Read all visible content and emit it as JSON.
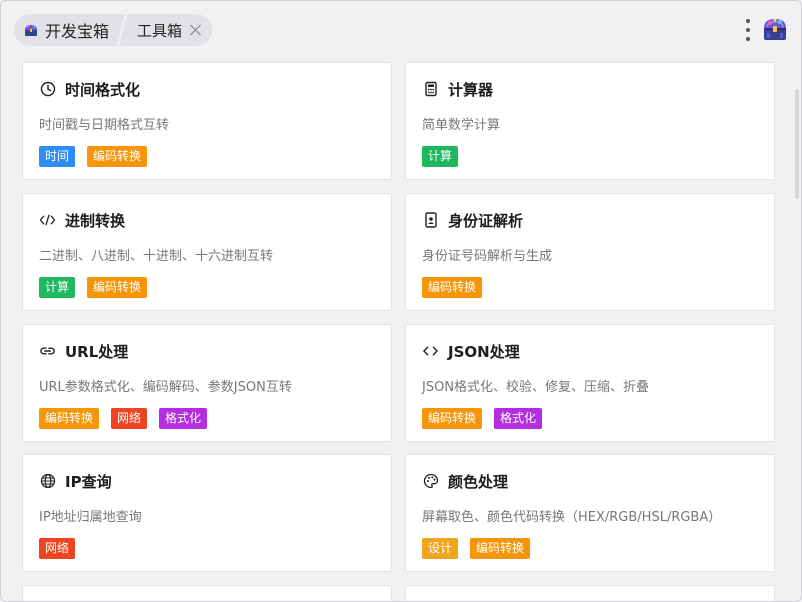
{
  "header": {
    "root_label": "开发宝箱",
    "tool_label": "工具箱",
    "app_icon": "treasure-chest-icon",
    "close_icon": "close-icon",
    "more_icon": "more-vertical-icon"
  },
  "tag_colors": {
    "时间": "#2f8df6",
    "编码转换": "#f5960a",
    "计算": "#20b761",
    "网络": "#ee4421",
    "格式化": "#b42ee0",
    "设计": "#f0a51c"
  },
  "cards": [
    {
      "title": "时间格式化",
      "icon": "clock-icon",
      "desc": "时间戳与日期格式互转",
      "tags": [
        "时间",
        "编码转换"
      ]
    },
    {
      "title": "计算器",
      "icon": "calculator-icon",
      "desc": "简单数学计算",
      "tags": [
        "计算"
      ]
    },
    {
      "title": "进制转换",
      "icon": "code-slash-icon",
      "desc": "二进制、八进制、十进制、十六进制互转",
      "tags": [
        "计算",
        "编码转换"
      ]
    },
    {
      "title": "身份证解析",
      "icon": "id-card-icon",
      "desc": "身份证号码解析与生成",
      "tags": [
        "编码转换"
      ]
    },
    {
      "title": "URL处理",
      "icon": "link-icon",
      "desc": "URL参数格式化、编码解码、参数JSON互转",
      "tags": [
        "编码转换",
        "网络",
        "格式化"
      ]
    },
    {
      "title": "JSON处理",
      "icon": "code-brackets-icon",
      "desc": "JSON格式化、校验、修复、压缩、折叠",
      "tags": [
        "编码转换",
        "格式化"
      ]
    },
    {
      "title": "IP查询",
      "icon": "globe-icon",
      "desc": "IP地址归属地查询",
      "tags": [
        "网络"
      ]
    },
    {
      "title": "颜色处理",
      "icon": "palette-icon",
      "desc": "屏幕取色、颜色代码转换（HEX/RGB/HSL/RGBA）",
      "tags": [
        "设计",
        "编码转换"
      ]
    }
  ]
}
